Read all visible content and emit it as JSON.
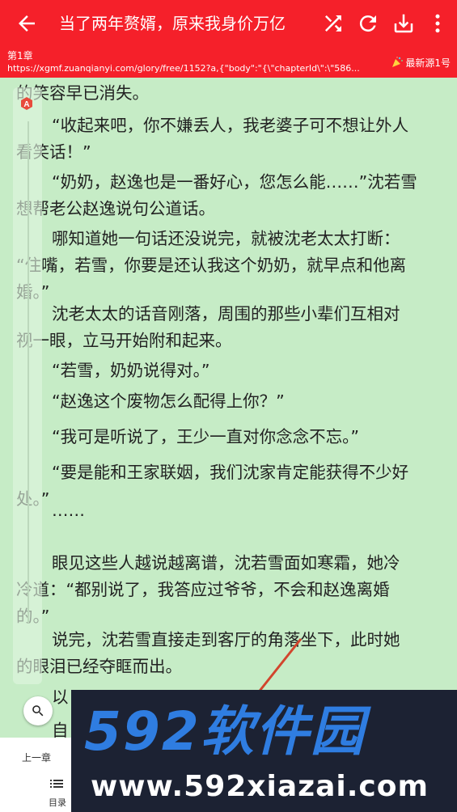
{
  "app_bar": {
    "title": "当了两年赘婿，原来我身价万亿",
    "icons": [
      "back-arrow-icon",
      "shuffle-icon",
      "refresh-icon",
      "download-icon",
      "more-vert-icon"
    ]
  },
  "sub_bar": {
    "chapter": "第1章",
    "url": "https://xgmf.zuanqianyi.com/glory/free/1152?a,{\"body\":\"{\\\"chapterId\\\":\\\"586...",
    "source": "最新源1号",
    "source_icon": "party-popper-icon"
  },
  "reader": {
    "paragraphs": [
      [
        "的笑容早已消失。"
      ],
      [
        "“收起来吧，你不嫌丢人，我老婆子可不想让外人",
        "看笑话！”"
      ],
      [
        "“奶奶，赵逸也是一番好心，您怎么能……”沈若雪",
        "想帮老公赵逸说句公道话。"
      ],
      [
        "哪知道她一句话还没说完，就被沈老太太打断：",
        "“住嘴，若雪，你要是还认我这个奶奶，就早点和他离",
        "婚。”"
      ],
      [
        "沈老太太的话音刚落，周围的那些小辈们互相对",
        "视一眼，立马开始附和起来。"
      ],
      [
        "“若雪，奶奶说得对。”"
      ],
      [
        "“赵逸这个废物怎么配得上你？”"
      ],
      [
        "“我可是听说了，王少一直对你念念不忘。”"
      ],
      [
        "“要是能和王家联姻，我们沈家肯定能获得不少好",
        "处。”"
      ],
      [
        "……"
      ],
      [
        "眼见这些人越说越离谱，沈若雪面如寒霜，她冷",
        "冷道：“都别说了，我答应过爷爷，不会和赵逸离婚",
        "的。”"
      ],
      [
        "说完，沈若雪直接走到客厅的角落坐下，此时她",
        "的眼泪已经夺眶而出。"
      ],
      [
        "以"
      ],
      [
        "自"
      ]
    ]
  },
  "side_panel": {
    "badge": "A",
    "icons": [
      "font-badge-icon",
      "search-icon"
    ]
  },
  "bottom_panel": {
    "prev_chapter": "上一章",
    "toc": "目录",
    "icons": [
      "toc-list-icon"
    ]
  },
  "watermark": {
    "logo": "592软件园",
    "url": "www.592xiazai.com"
  },
  "colors": {
    "toolbar_red": "#f5202a",
    "reader_bg": "#c6ecc6",
    "text": "#222222",
    "watermark_bg": "#1c2233",
    "watermark_blue": "#2f7de1"
  }
}
